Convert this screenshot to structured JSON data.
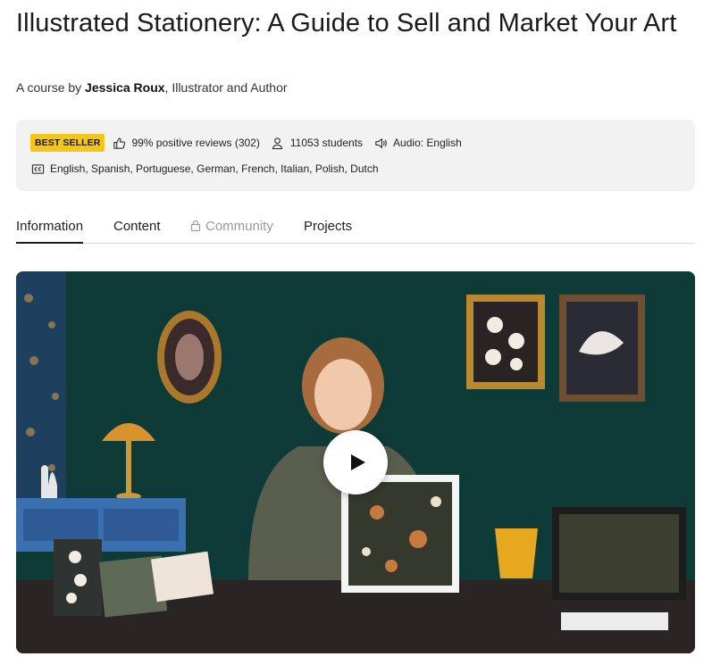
{
  "course": {
    "title": "Illustrated Stationery: A Guide to Sell and Market Your Art",
    "byline_prefix": "A course by ",
    "author": "Jessica Roux",
    "byline_suffix": ", Illustrator and Author"
  },
  "meta": {
    "badge": "BEST SELLER",
    "reviews": "99% positive reviews (302)",
    "students": "11053 students",
    "audio": "Audio: English",
    "subtitles": "English, Spanish, Portuguese, German, French, Italian, Polish, Dutch",
    "icons": {
      "reviews": "thumbs-up-icon",
      "students": "user-icon",
      "audio": "speaker-icon",
      "subtitles": "closed-captions-icon"
    },
    "badge_color": "#f5c518"
  },
  "tabs": [
    {
      "label": "Information",
      "active": true
    },
    {
      "label": "Content",
      "active": false
    },
    {
      "label": "Community",
      "active": false,
      "locked": true
    },
    {
      "label": "Projects",
      "active": false
    }
  ],
  "video": {
    "play_icon": "play-icon",
    "background_color": "#0f3a36"
  }
}
